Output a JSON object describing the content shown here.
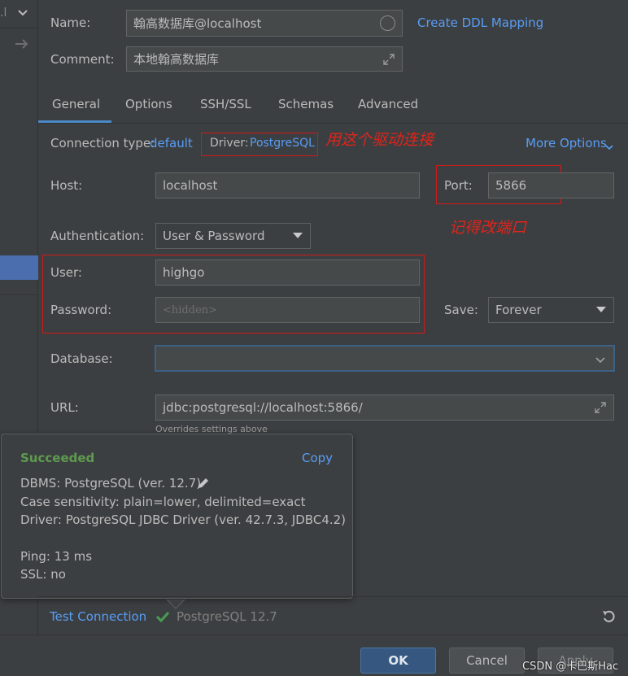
{
  "left_panel": {
    "top_label": ".l",
    "arrow": "→"
  },
  "name_field": {
    "label": "Name:",
    "value": "翰高数据库@localhost",
    "link": "Create DDL Mapping"
  },
  "comment_field": {
    "label": "Comment:",
    "value": "本地翰高数据库"
  },
  "tabs": [
    "General",
    "Options",
    "SSH/SSL",
    "Schemas",
    "Advanced"
  ],
  "connection": {
    "type_label": "Connection type:",
    "type_value": "default",
    "driver_label": "Driver:",
    "driver_value": "PostgreSQL",
    "more_options": "More Options"
  },
  "annotations": {
    "driver_note": "用这个驱动连接",
    "port_note": "记得改端口"
  },
  "host": {
    "label": "Host:",
    "value": "localhost"
  },
  "port": {
    "label": "Port:",
    "value": "5866"
  },
  "auth": {
    "label": "Authentication:",
    "value": "User & Password"
  },
  "user": {
    "label": "User:",
    "value": "highgo"
  },
  "password": {
    "label": "Password:",
    "placeholder": "<hidden>"
  },
  "save": {
    "label": "Save:",
    "value": "Forever"
  },
  "database": {
    "label": "Database:",
    "value": ""
  },
  "url": {
    "label": "URL:",
    "value": "jdbc:postgresql://localhost:5866/",
    "hint": "Overrides settings above"
  },
  "popup": {
    "title": "Succeeded",
    "copy": "Copy",
    "lines": [
      "DBMS: PostgreSQL (ver. 12.7)",
      "Case sensitivity: plain=lower, delimited=exact",
      "Driver: PostgreSQL JDBC Driver (ver. 42.7.3, JDBC4.2)",
      "",
      "Ping: 13 ms",
      "SSL: no"
    ]
  },
  "footer": {
    "test_connection": "Test Connection",
    "status": "PostgreSQL 12.7",
    "ok": "OK",
    "cancel": "Cancel",
    "apply": "Apply",
    "watermark": "CSDN @卡巴斯Hac"
  },
  "colors": {
    "accent": "#589df6",
    "success": "#499c54",
    "annotation": "#e0231b",
    "ok_button": "#365880"
  }
}
